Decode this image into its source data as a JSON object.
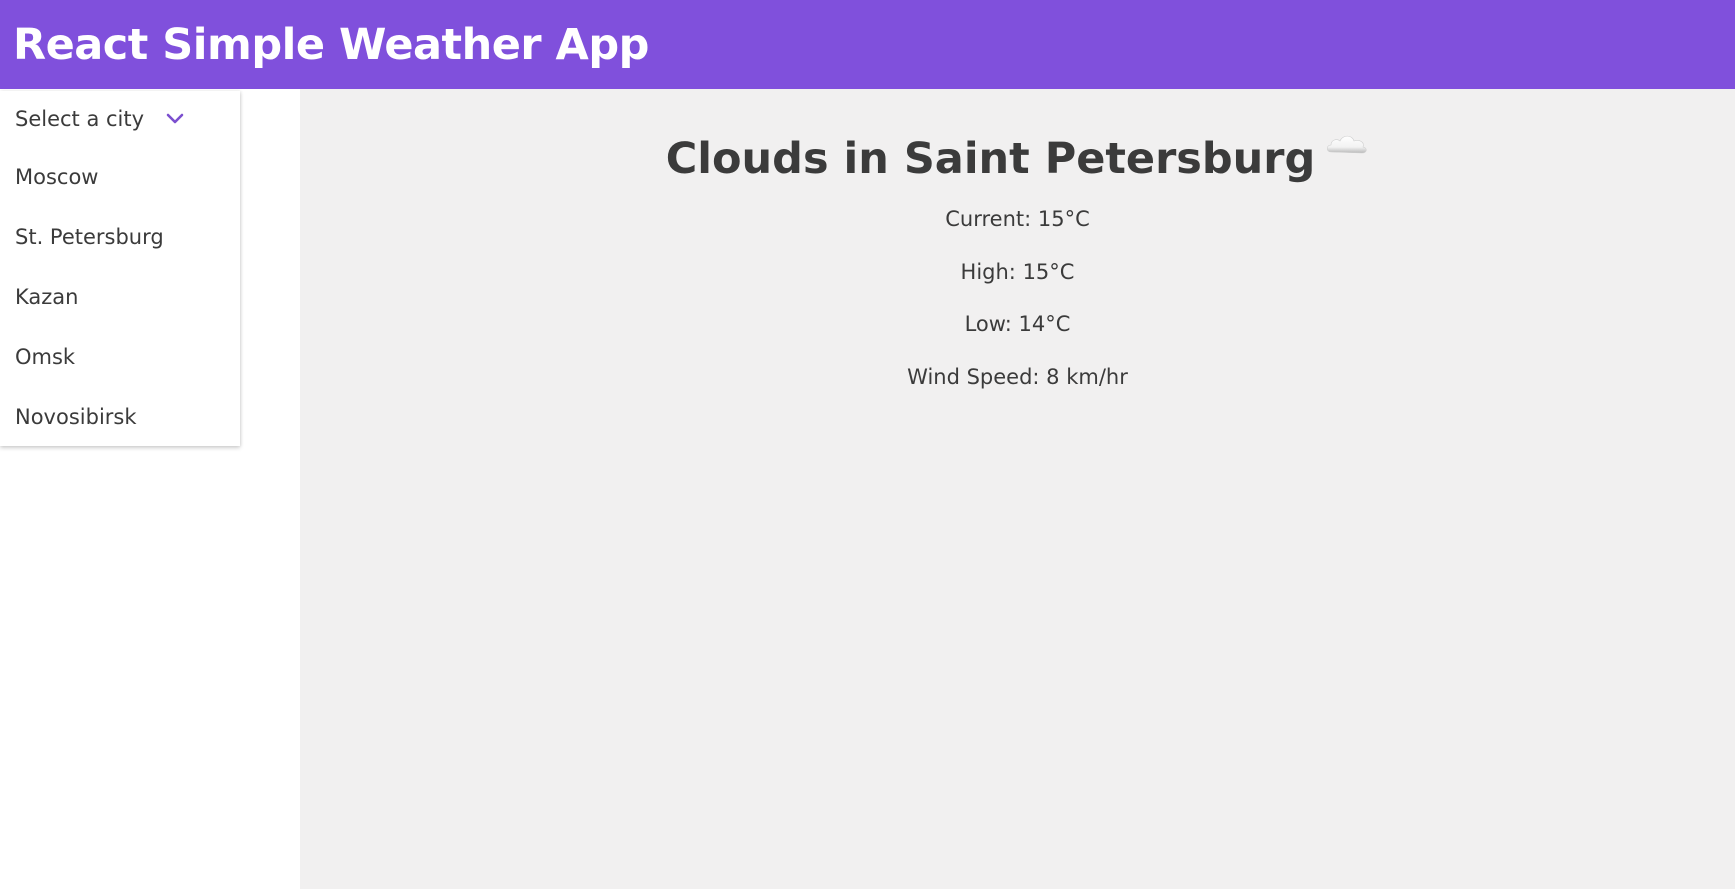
{
  "header": {
    "title": "React Simple Weather App"
  },
  "sidebar": {
    "dropdown": {
      "label": "Select a city",
      "chevron_icon": "chevron-down-icon",
      "options": [
        {
          "label": "Moscow"
        },
        {
          "label": "St. Petersburg"
        },
        {
          "label": "Kazan"
        },
        {
          "label": "Omsk"
        },
        {
          "label": "Novosibirsk"
        }
      ]
    }
  },
  "weather": {
    "title": "Clouds in Saint Petersburg",
    "icon": "cloud-icon",
    "current": "Current: 15°C",
    "high": "High: 15°C",
    "low": "Low: 14°C",
    "wind": "Wind Speed: 8 km/hr"
  },
  "colors": {
    "header_bg": "#8050dc",
    "accent": "#7b4fcf",
    "main_bg": "#f1f0f0",
    "text": "#3b3b3b"
  }
}
